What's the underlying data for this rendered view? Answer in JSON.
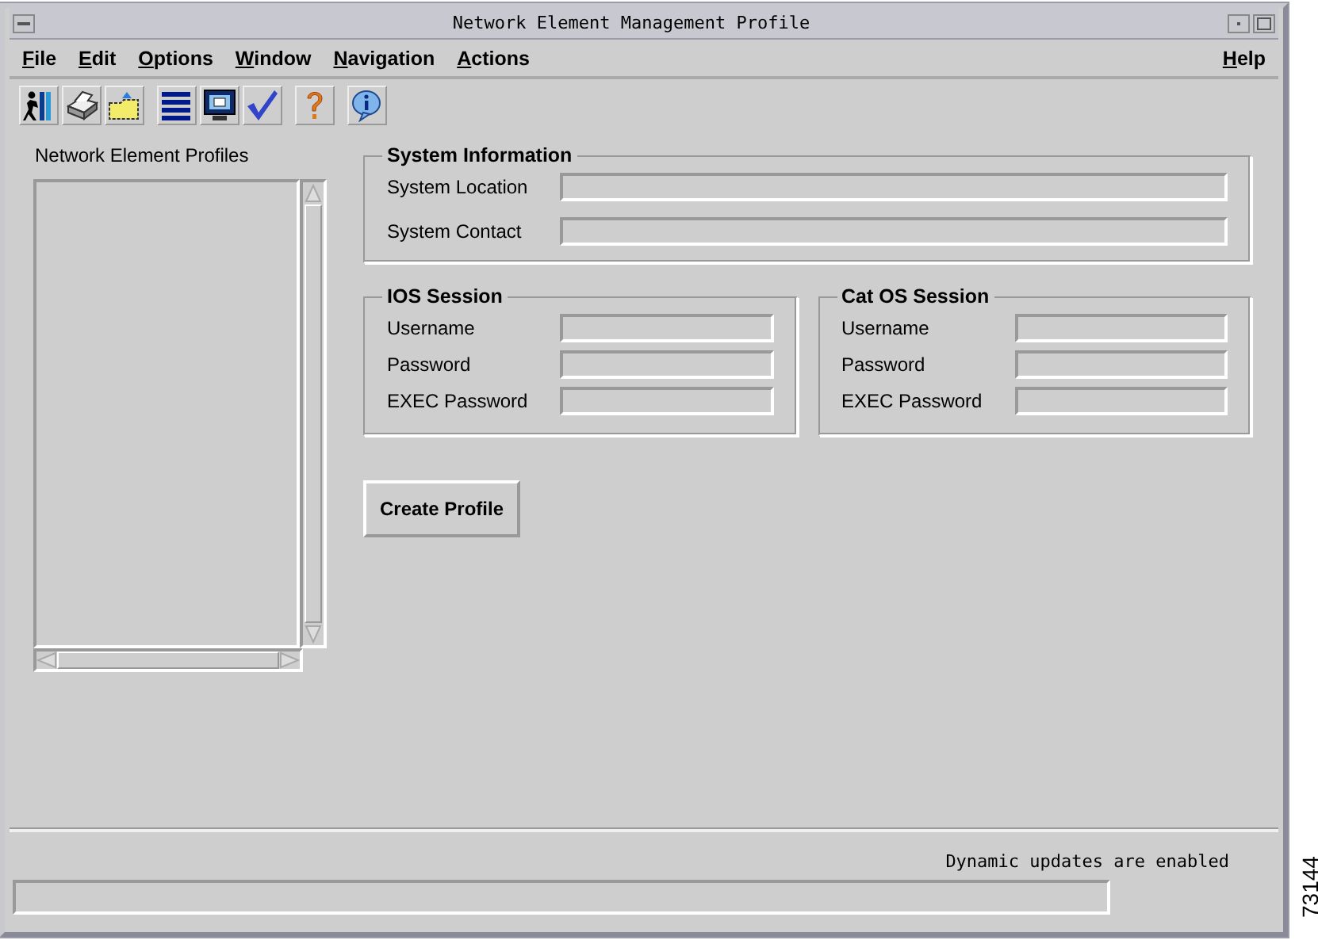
{
  "window": {
    "title": "Network Element Management Profile"
  },
  "menu": [
    {
      "label": "File"
    },
    {
      "label": "Edit"
    },
    {
      "label": "Options"
    },
    {
      "label": "Window"
    },
    {
      "label": "Navigation"
    },
    {
      "label": "Actions"
    }
  ],
  "help_menu": {
    "label": "Help"
  },
  "toolbar": [
    [
      {
        "kind": "exit"
      },
      {
        "kind": "print"
      },
      {
        "kind": "open"
      }
    ],
    [
      {
        "kind": "list"
      },
      {
        "kind": "monitor"
      },
      {
        "kind": "check"
      }
    ],
    [
      {
        "kind": "help"
      }
    ],
    [
      {
        "kind": "info"
      }
    ]
  ],
  "profiles": {
    "title": "Network Element Profiles"
  },
  "groups": [
    {
      "title": "System Information",
      "kind": "wide",
      "fields": [
        {
          "label": "System Location"
        },
        {
          "label": "System Contact"
        }
      ]
    },
    {
      "title": "IOS Session",
      "kind": "narrow",
      "fields": [
        {
          "label": "Username"
        },
        {
          "label": "Password"
        },
        {
          "label": "EXEC Password"
        }
      ]
    },
    {
      "title": "Cat OS Session",
      "kind": "narrow",
      "fields": [
        {
          "label": "Username"
        },
        {
          "label": "Password"
        },
        {
          "label": "EXEC Password"
        }
      ]
    }
  ],
  "buttons": [
    "Create Profile"
  ],
  "status_bar": {
    "message": "Dynamic updates are enabled"
  },
  "figure_number": "73144"
}
